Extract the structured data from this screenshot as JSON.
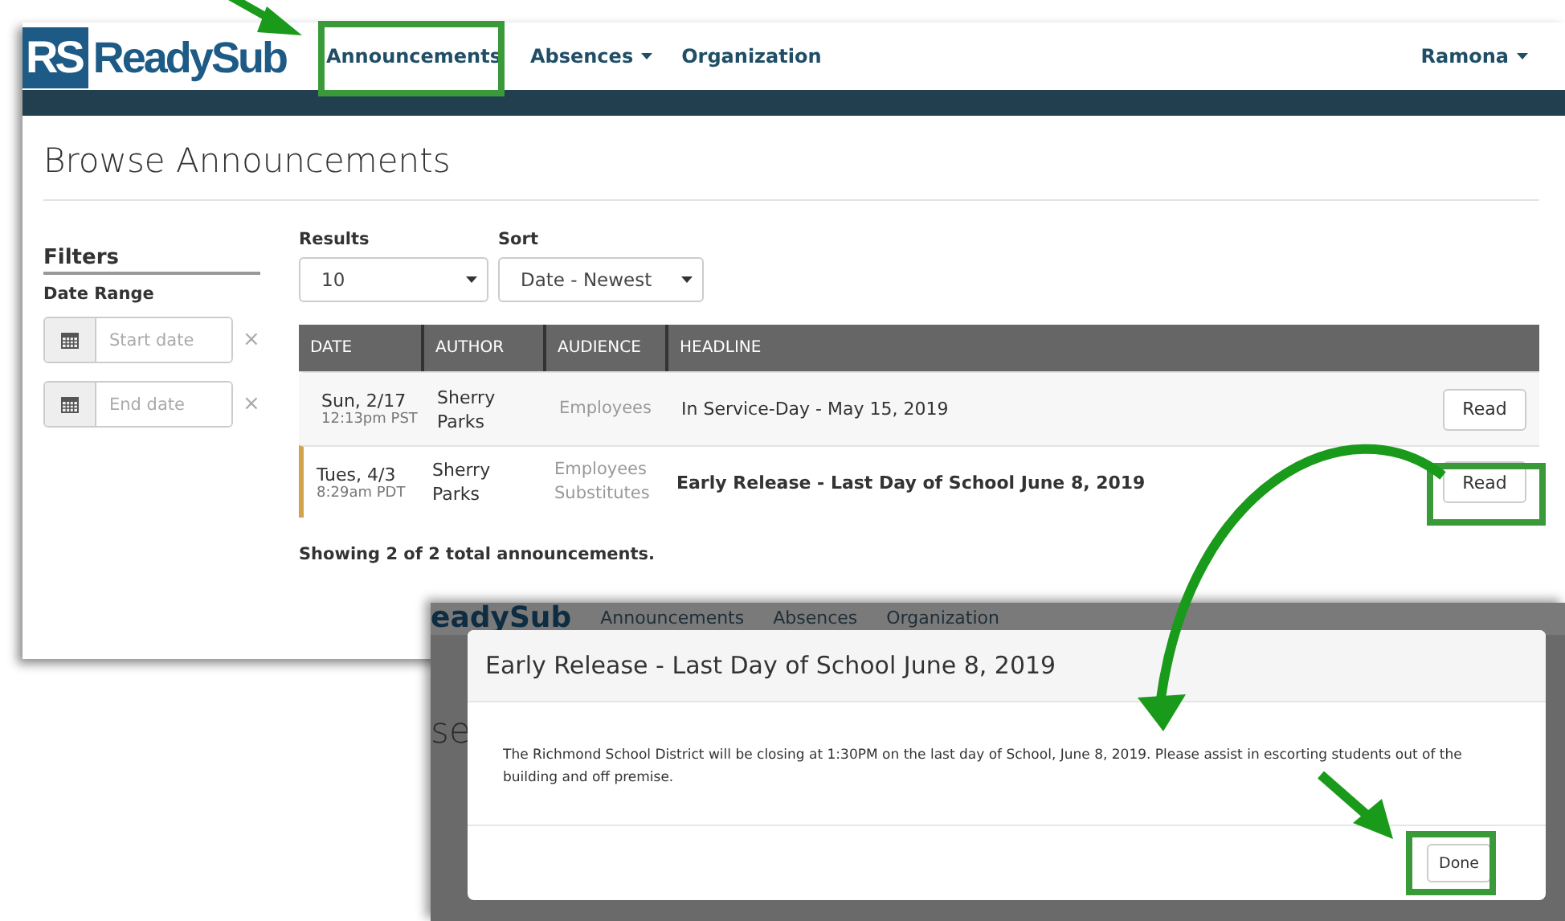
{
  "main_screen": {
    "logo": {
      "initials": "RS",
      "name": "ReadySub"
    },
    "nav": [
      {
        "label": "Announcements",
        "has_menu": false
      },
      {
        "label": "Absences",
        "has_menu": true
      },
      {
        "label": "Organization",
        "has_menu": false
      }
    ],
    "user_menu": {
      "label": "Ramona",
      "has_menu": true
    },
    "page_title": "Browse Announcements",
    "filters": {
      "title": "Filters",
      "date_range_label": "Date Range",
      "fields": [
        {
          "placeholder": "Start date"
        },
        {
          "placeholder": "End date"
        }
      ],
      "clear_symbol": "×"
    },
    "results": {
      "label": "Results",
      "value": "10"
    },
    "sort": {
      "label": "Sort",
      "value": "Date - Newest"
    },
    "table": {
      "columns": [
        "DATE",
        "AUTHOR",
        "AUDIENCE",
        "HEADLINE"
      ],
      "rows": [
        {
          "date": "Sun, 2/17",
          "time": "12:13pm PST",
          "author": [
            "Sherry",
            "Parks"
          ],
          "audience": [
            "Employees"
          ],
          "headline": "In Service-Day - May 15, 2019",
          "unread": false,
          "action": "Read"
        },
        {
          "date": "Tues, 4/3",
          "time": "8:29am PDT",
          "author": [
            "Sherry",
            "Parks"
          ],
          "audience": [
            "Employees",
            "Substitutes"
          ],
          "headline": "Early Release - Last Day of School June 8, 2019",
          "unread": true,
          "action": "Read"
        }
      ]
    },
    "summary": "Showing 2 of 2 total announcements."
  },
  "dialog_screen": {
    "background": {
      "logo_fragment": "eadySub",
      "nav": [
        "Announcements",
        "Absences",
        "Organization"
      ],
      "title_fragment": "se"
    },
    "dialog": {
      "title": "Early Release - Last Day of School June 8, 2019",
      "body": "The Richmond School District will be closing at 1:30PM on the last day of School, June 8, 2019. Please assist in escorting students out of the building and off premise.",
      "button": "Done"
    }
  }
}
